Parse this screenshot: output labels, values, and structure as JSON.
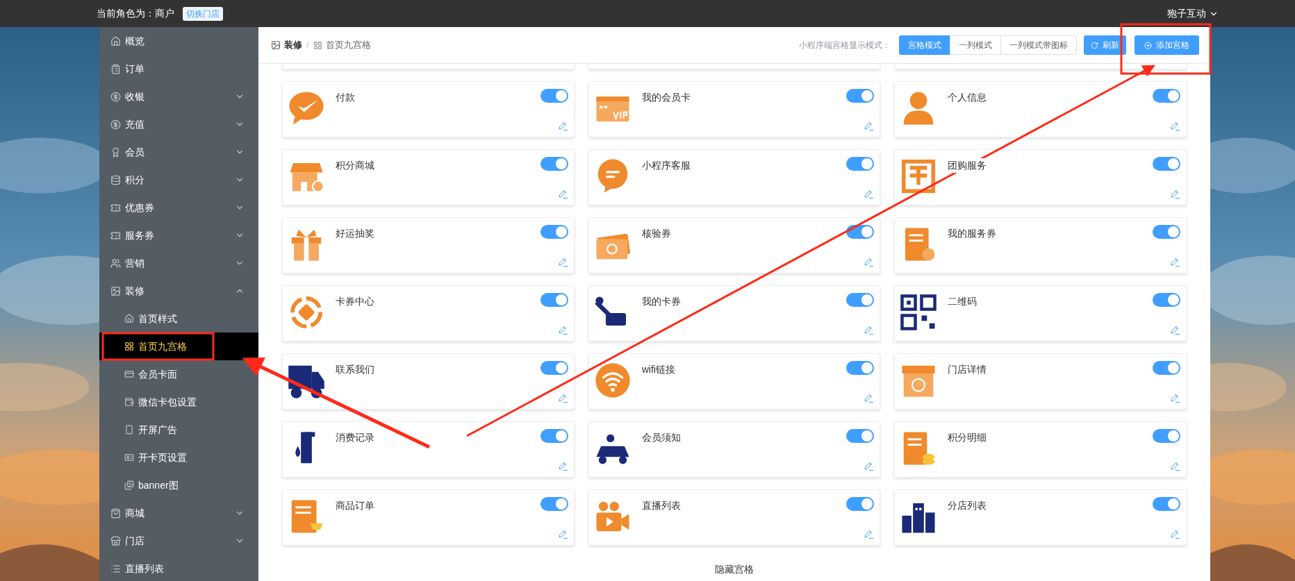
{
  "top_bar": {
    "role_label": "当前角色为：商户",
    "switch_store_button": "切换门店",
    "account": "狍子互动"
  },
  "sidebar": {
    "items": [
      {
        "label": "概览",
        "kind": "link",
        "selected": false
      },
      {
        "label": "订单",
        "kind": "link",
        "selected": false
      },
      {
        "label": "收银",
        "kind": "group",
        "expanded": false,
        "selected": false
      },
      {
        "label": "充值",
        "kind": "group",
        "expanded": false,
        "selected": false
      },
      {
        "label": "会员",
        "kind": "group",
        "expanded": false,
        "selected": false
      },
      {
        "label": "积分",
        "kind": "group",
        "expanded": false,
        "selected": false
      },
      {
        "label": "优惠券",
        "kind": "group",
        "expanded": false,
        "selected": false
      },
      {
        "label": "服务券",
        "kind": "group",
        "expanded": false,
        "selected": false
      },
      {
        "label": "营销",
        "kind": "group",
        "expanded": false,
        "selected": false
      },
      {
        "label": "装修",
        "kind": "group",
        "expanded": true,
        "selected": false,
        "children": [
          {
            "label": "首页样式",
            "selected": false
          },
          {
            "label": "首页九宫格",
            "selected": true
          },
          {
            "label": "会员卡面",
            "selected": false
          },
          {
            "label": "微信卡包设置",
            "selected": false
          },
          {
            "label": "开屏广告",
            "selected": false
          },
          {
            "label": "开卡页设置",
            "selected": false
          },
          {
            "label": "banner图",
            "selected": false
          }
        ]
      },
      {
        "label": "商城",
        "kind": "group",
        "expanded": false,
        "selected": false
      },
      {
        "label": "门店",
        "kind": "group",
        "expanded": false,
        "selected": false
      },
      {
        "label": "直播列表",
        "kind": "link",
        "selected": false
      }
    ]
  },
  "header": {
    "breadcrumb": [
      {
        "label": "装修"
      },
      {
        "label": "首页九宫格"
      }
    ],
    "separator": "/",
    "mode_label": "小程序端宫格显示模式：",
    "modes": [
      {
        "label": "宫格模式",
        "selected": true
      },
      {
        "label": "一列模式",
        "selected": false
      },
      {
        "label": "一列模式带图标",
        "selected": false
      }
    ],
    "refresh_button": "刷新",
    "add_button": "添加宫格"
  },
  "tiles": [
    {
      "name": "付款",
      "enabled": true
    },
    {
      "name": "我的会员卡",
      "enabled": true
    },
    {
      "name": "个人信息",
      "enabled": true
    },
    {
      "name": "积分商城",
      "enabled": true
    },
    {
      "name": "小程序客服",
      "enabled": true
    },
    {
      "name": "团购服务",
      "enabled": true
    },
    {
      "name": "好运抽奖",
      "enabled": true
    },
    {
      "name": "核验券",
      "enabled": true
    },
    {
      "name": "我的服务券",
      "enabled": true
    },
    {
      "name": "卡券中心",
      "enabled": true
    },
    {
      "name": "我的卡券",
      "enabled": true
    },
    {
      "name": "二维码",
      "enabled": true
    },
    {
      "name": "联系我们",
      "enabled": true
    },
    {
      "name": "wifi链接",
      "enabled": true
    },
    {
      "name": "门店详情",
      "enabled": true
    },
    {
      "name": "消费记录",
      "enabled": true
    },
    {
      "name": "会员须知",
      "enabled": true
    },
    {
      "name": "积分明细",
      "enabled": true
    },
    {
      "name": "商品订单",
      "enabled": true
    },
    {
      "name": "直播列表",
      "enabled": true
    },
    {
      "name": "分店列表",
      "enabled": true
    }
  ],
  "hidden_section_title": "隐藏宫格"
}
